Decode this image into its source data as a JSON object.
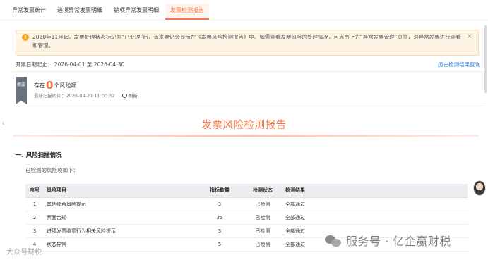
{
  "tabs": [
    {
      "label": "异常发票统计",
      "active": false
    },
    {
      "label": "进项异常发票明细",
      "active": false
    },
    {
      "label": "销项异常发票明细",
      "active": false
    },
    {
      "label": "发票检测报告",
      "active": true
    }
  ],
  "notice": {
    "text": "2020年11月起，发票处理状态标记为“已处理”后，该发票仍会显示在《发票风险检测报告》中。如需查看发票风险的处理情况，可点击上方“异常发票管理”页签，对异常发票进行查看和管理。",
    "icon": "warning-icon",
    "close_glyph": "×"
  },
  "date_range": {
    "label": "开票日期起止：",
    "start": "2026-04-01",
    "sep": "至",
    "end": "2026-04-30"
  },
  "history_link": "历史检测结果查询",
  "summary": {
    "tag": "摘要",
    "prefix": "存在",
    "count": "0",
    "suffix": "个风险项",
    "scan_label": "最新扫描时间：",
    "scan_time": "2026-04-21 11:00:32",
    "refresh_label": "刷新"
  },
  "report_title": "发票风险检测报告",
  "section": {
    "heading": "一. 风险扫描情况",
    "subtitle": "已检测的风险项如下："
  },
  "table": {
    "headers": [
      "序号",
      "风险项目",
      "指标数量",
      "检测状态",
      "检测结果"
    ],
    "rows": [
      {
        "no": "1",
        "item": "其他综合风险提示",
        "count": "3",
        "status": "已检测",
        "result": "全部通过"
      },
      {
        "no": "2",
        "item": "票面合规",
        "count": "35",
        "status": "已检测",
        "result": "全部通过"
      },
      {
        "no": "3",
        "item": "进项发票收票行为相关风险提示",
        "count": "3",
        "status": "已检测",
        "result": "全部通过"
      },
      {
        "no": "4",
        "item": "状态异常",
        "count": "5",
        "status": "已检测",
        "result": "全部通过"
      }
    ]
  },
  "watermark": "服务号 · 亿企赢财税",
  "watermark_left": "大众号财税",
  "colors": {
    "accent": "#f5774a",
    "link": "#2b7fd6",
    "notice_bg": "#fdf4e3",
    "notice_icon": "#f5a623"
  }
}
